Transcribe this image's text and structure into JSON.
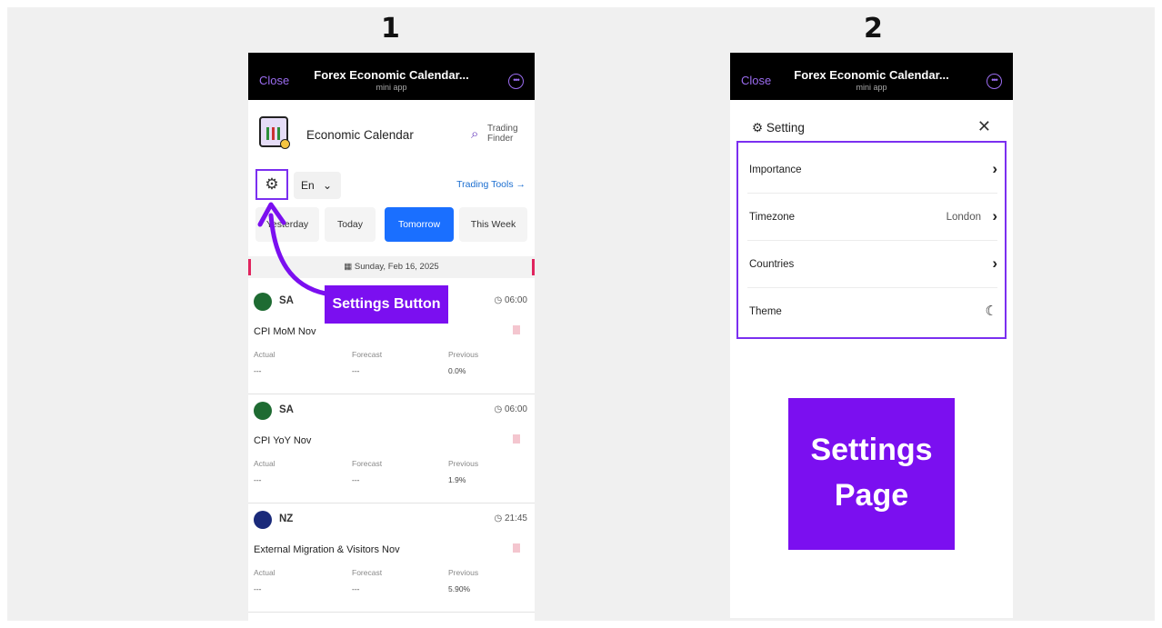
{
  "panels": [
    {
      "step": "1"
    },
    {
      "step": "2"
    }
  ],
  "topbar": {
    "close_label": "Close",
    "title": "Forex Economic Calendar...",
    "subtitle": "mini app",
    "more_icon": "ellipsis-circle-icon"
  },
  "app": {
    "name": "Economic Calendar",
    "brand_line1": "Trading",
    "brand_line2": "Finder"
  },
  "controls": {
    "settings_icon": "gear-icon",
    "language": "En",
    "tools_link": "Trading Tools →"
  },
  "day_tabs": [
    {
      "label": "Yesterday",
      "active": false
    },
    {
      "label": "Today",
      "active": false
    },
    {
      "label": "Tomorrow",
      "active": true
    },
    {
      "label": "This Week",
      "active": false
    }
  ],
  "date_label": "Sunday, Feb 16, 2025",
  "columns": {
    "actual": "Actual",
    "forecast": "Forecast",
    "previous": "Previous"
  },
  "events": [
    {
      "country": "SA",
      "time": "06:00",
      "name": "CPI MoM Nov",
      "actual": "---",
      "forecast": "---",
      "previous": "0.0%"
    },
    {
      "country": "SA",
      "time": "06:00",
      "name": "CPI YoY Nov",
      "actual": "---",
      "forecast": "---",
      "previous": "1.9%"
    },
    {
      "country": "NZ",
      "time": "21:45",
      "name": "External Migration & Visitors Nov",
      "actual": "---",
      "forecast": "---",
      "previous": "5.90%"
    }
  ],
  "callouts": {
    "settings_button": "Settings Button",
    "settings_page_line1": "Settings",
    "settings_page_line2": "Page"
  },
  "settings": {
    "title": "Setting",
    "rows": [
      {
        "label": "Importance",
        "value": ""
      },
      {
        "label": "Timezone",
        "value": "London"
      },
      {
        "label": "Countries",
        "value": ""
      },
      {
        "label": "Theme",
        "value": ""
      }
    ]
  },
  "colors": {
    "accent": "#7b0ff0",
    "active_tab": "#1a6fff",
    "link": "#1b6ed0"
  }
}
